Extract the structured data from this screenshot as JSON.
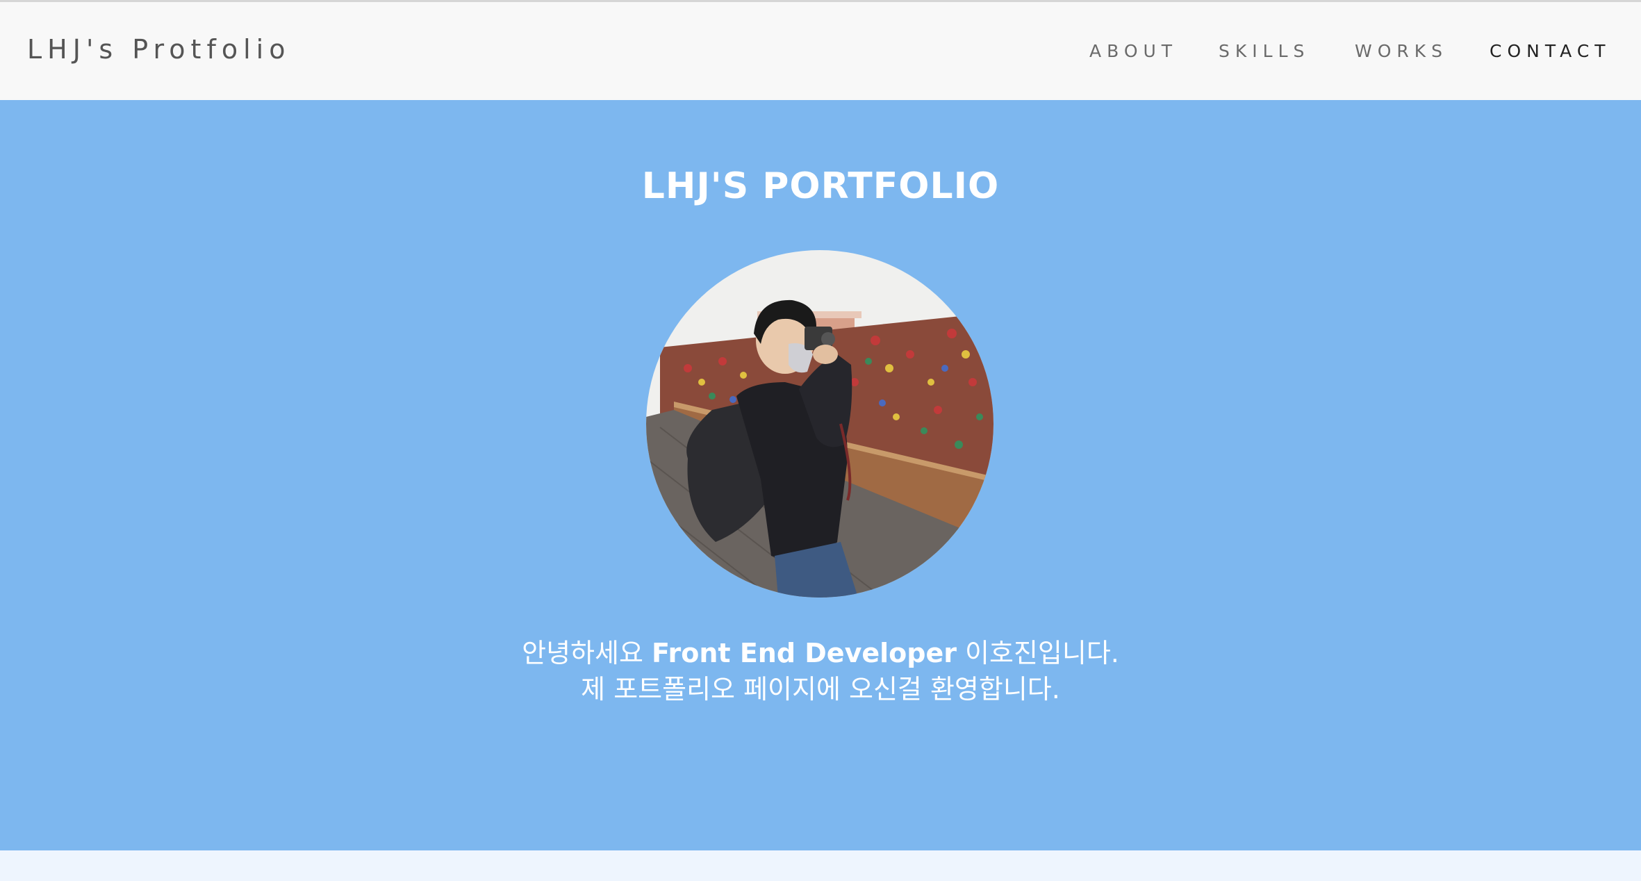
{
  "navbar": {
    "brand": "LHJ's Protfolio",
    "items": [
      {
        "label": "ABOUT"
      },
      {
        "label": "SKILLS"
      },
      {
        "label": "WORKS"
      },
      {
        "label": "CONTACT"
      }
    ],
    "active_item": "CONTACT"
  },
  "hero": {
    "title": "LHJ'S PORTFOLIO",
    "avatar_icon": "profile-photo",
    "intro": {
      "line1_prefix": "안녕하세요 ",
      "line1_bold": "Front End Developer",
      "line1_suffix": " 이호진입니다.",
      "line2": "제 포트폴리오 페이지에 오신걸 환영합니다."
    }
  },
  "colors": {
    "navbar_bg": "#f8f8f8",
    "hero_bg": "#7db7ef",
    "hero_text": "#ffffff",
    "nav_text": "#6a6a6a",
    "nav_active": "#222222"
  }
}
